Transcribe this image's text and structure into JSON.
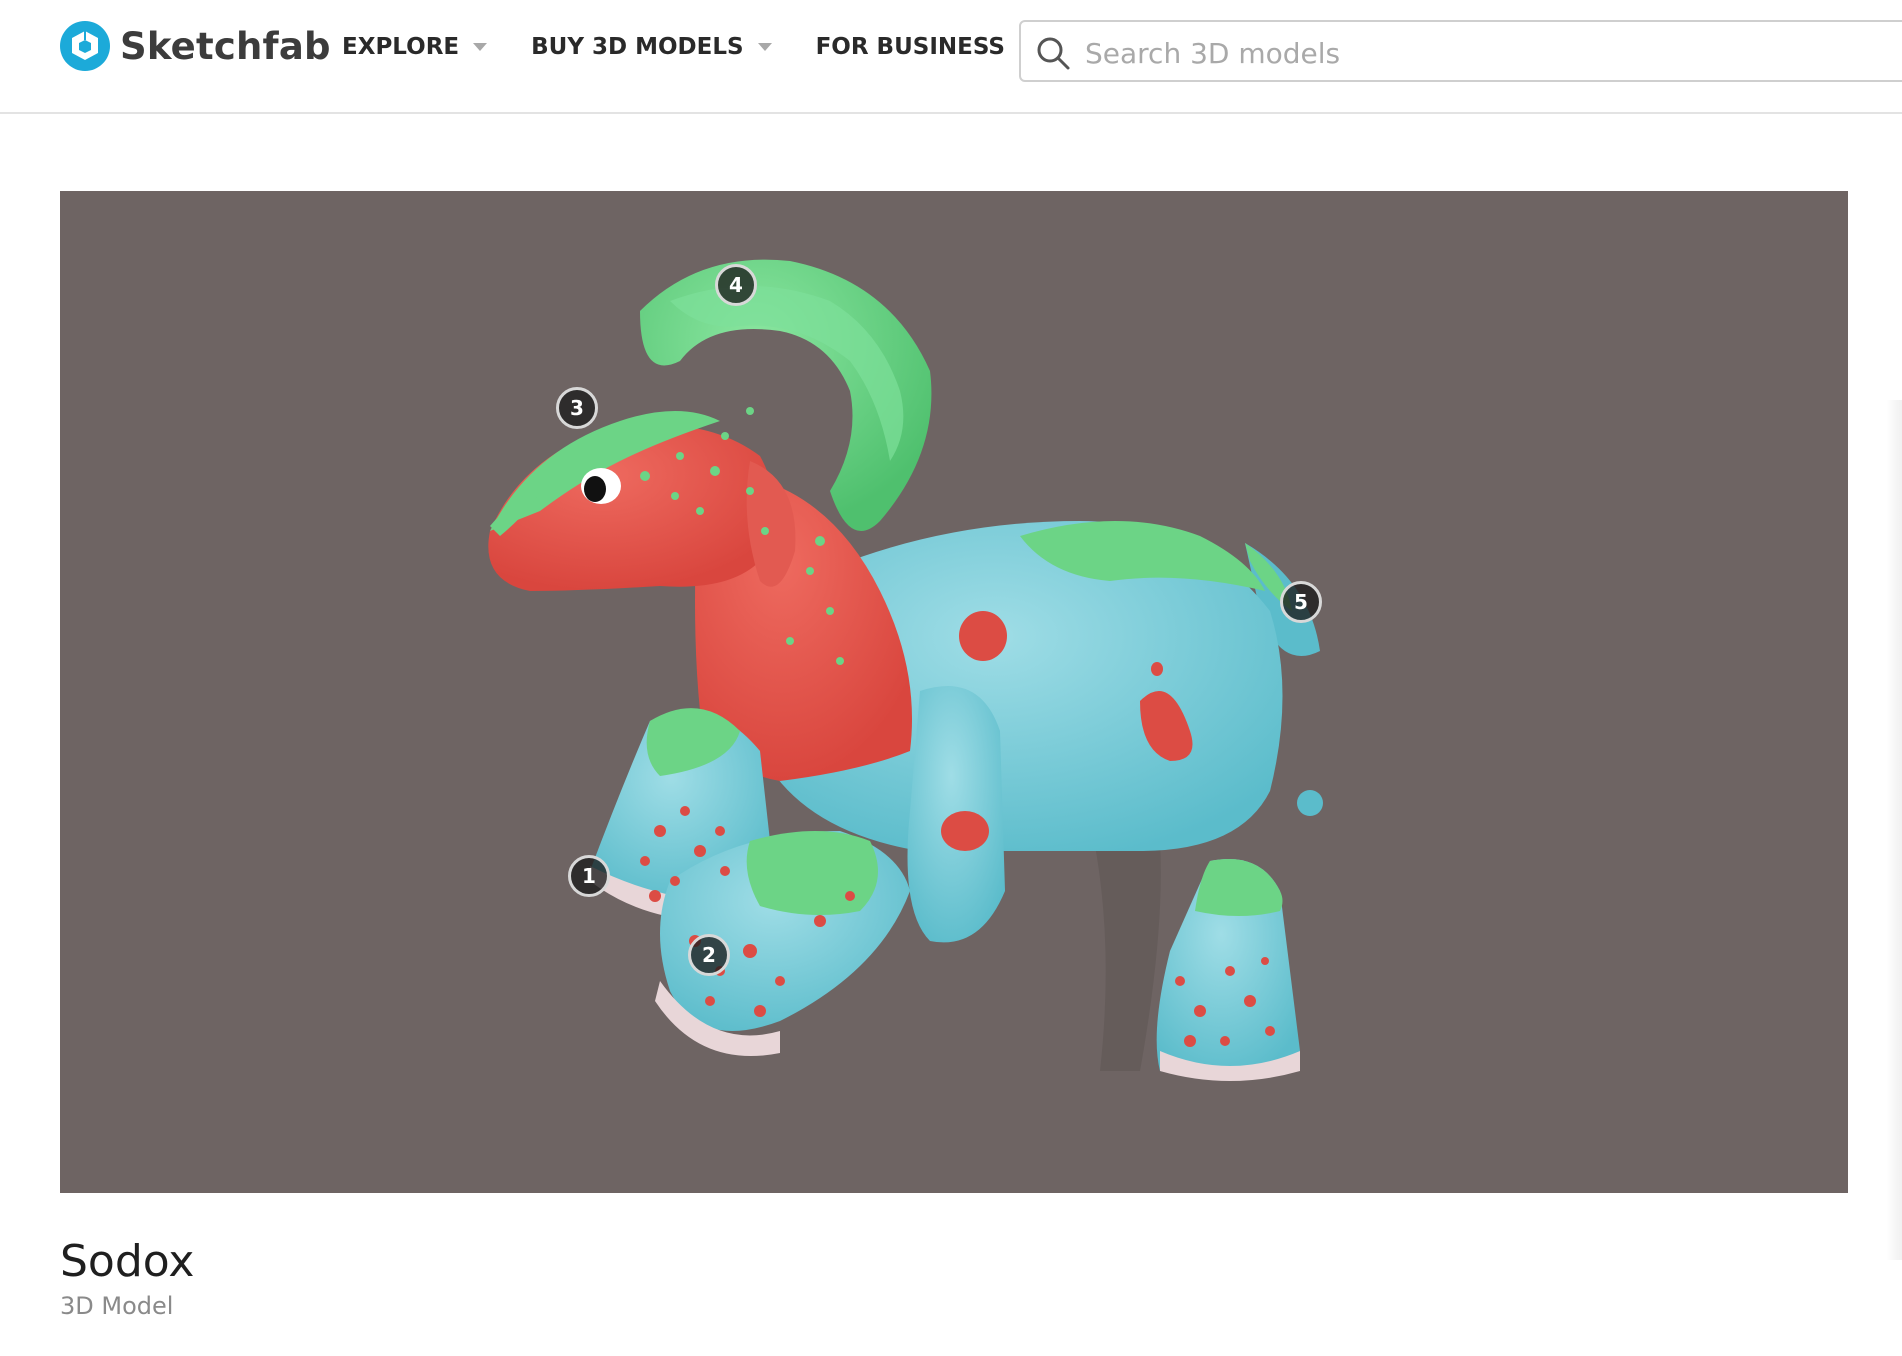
{
  "brand": {
    "name": "Sketchfab",
    "logo_icon": "sketchfab-cube-icon",
    "accent": "#1caad9"
  },
  "nav": {
    "items": [
      {
        "label": "EXPLORE",
        "icon": "chevron-down-icon"
      },
      {
        "label": "BUY 3D MODELS",
        "icon": "chevron-down-icon"
      },
      {
        "label": "FOR BUSINESS",
        "icon": "chevron-down-icon"
      }
    ]
  },
  "search": {
    "placeholder": "Search 3D models",
    "value": "",
    "icon": "search-icon"
  },
  "viewer": {
    "background": "#6e6463",
    "hotspots": [
      "1",
      "2",
      "3",
      "4",
      "5"
    ]
  },
  "model": {
    "title": "Sodox",
    "subtitle": "3D Model"
  }
}
